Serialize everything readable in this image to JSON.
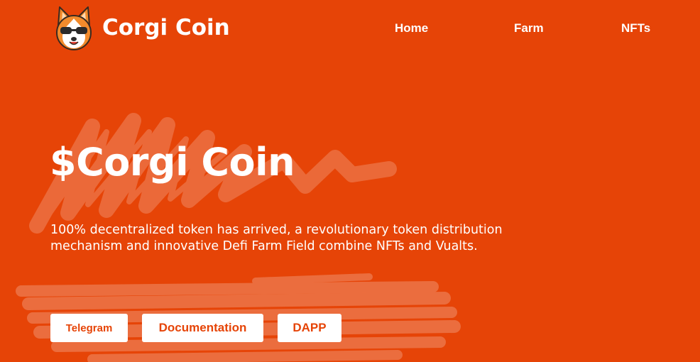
{
  "header": {
    "brand": "Corgi Coin",
    "logo_icon": "corgi-logo-icon",
    "nav": [
      {
        "label": "Home"
      },
      {
        "label": "Farm"
      },
      {
        "label": "NFTs"
      }
    ]
  },
  "hero": {
    "title": "$Corgi Coin",
    "description": "100% decentralized token has arrived, a revolutionary token distribution mechanism and innovative Defi Farm Field combine NFTs and Vualts.",
    "buttons": [
      {
        "label": "Telegram"
      },
      {
        "label": "Documentation"
      },
      {
        "label": "DAPP"
      }
    ]
  },
  "colors": {
    "background": "#e64407",
    "button_bg": "#ffffff",
    "button_text": "#e64407"
  }
}
